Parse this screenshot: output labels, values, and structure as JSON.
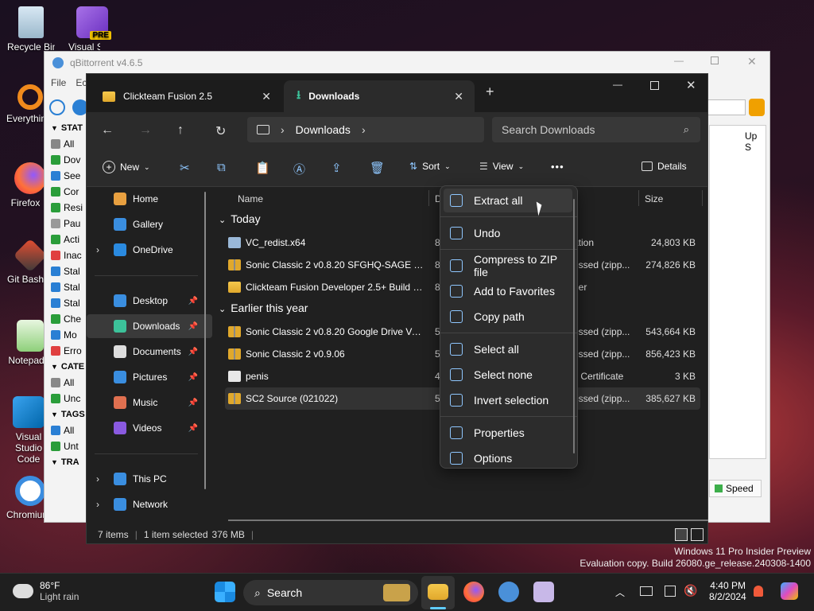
{
  "desktop": {
    "icons": [
      {
        "label": "Recycle Bin"
      },
      {
        "label": "Visual Studio"
      },
      {
        "label": "Everything"
      },
      {
        "label": "Firefox"
      },
      {
        "label": "Git Bash"
      },
      {
        "label": "Notepad"
      },
      {
        "label": "Visual Studio Code"
      },
      {
        "label": "Chromium"
      }
    ],
    "pre_badge": "PRE",
    "watermark_line1": "Windows 11 Pro Insider Preview",
    "watermark_line2": "Evaluation copy. Build 26080.ge_release.240308-1400"
  },
  "qbittorrent": {
    "title": "qBittorrent v4.6.5",
    "menu": [
      "File",
      "Ec"
    ],
    "sidebar": [
      {
        "label": "STAT",
        "header": true
      },
      {
        "label": "All"
      },
      {
        "label": "Dov"
      },
      {
        "label": "See"
      },
      {
        "label": "Cor"
      },
      {
        "label": "Resi"
      },
      {
        "label": "Pau"
      },
      {
        "label": "Acti"
      },
      {
        "label": "Inac"
      },
      {
        "label": "Stal"
      },
      {
        "label": "Stal"
      },
      {
        "label": "Stal"
      },
      {
        "label": "Che"
      },
      {
        "label": "Mo"
      },
      {
        "label": "Erro"
      },
      {
        "label": "CATE",
        "header": true
      },
      {
        "label": "All"
      },
      {
        "label": "Unc"
      },
      {
        "label": "TAGS",
        "header": true
      },
      {
        "label": "All"
      },
      {
        "label": "Unt"
      },
      {
        "label": "TRA",
        "header": true
      }
    ],
    "column_up": "Up S",
    "speed_button": "Speed"
  },
  "explorer": {
    "tabs": [
      {
        "label": "Clickteam Fusion 2.5",
        "active": false
      },
      {
        "label": "Downloads",
        "active": true
      }
    ],
    "add_tab": "+",
    "breadcrumb": "Downloads",
    "search_placeholder": "Search Downloads",
    "toolbar": {
      "new": "New",
      "sort": "Sort",
      "view": "View",
      "more": "•••",
      "details": "Details"
    },
    "nav": [
      {
        "label": "Home",
        "pinned": false
      },
      {
        "label": "Gallery",
        "pinned": false
      },
      {
        "label": "OneDrive",
        "pinned": false
      },
      {
        "label": "Desktop",
        "pinned": true
      },
      {
        "label": "Downloads",
        "pinned": true,
        "selected": true
      },
      {
        "label": "Documents",
        "pinned": true
      },
      {
        "label": "Pictures",
        "pinned": true
      },
      {
        "label": "Music",
        "pinned": true
      },
      {
        "label": "Videos",
        "pinned": true
      },
      {
        "label": "This PC",
        "pinned": false
      },
      {
        "label": "Network",
        "pinned": false
      }
    ],
    "columns": {
      "name": "Name",
      "date": "D",
      "size": "Size"
    },
    "groups": [
      {
        "label": "Today",
        "files": [
          {
            "name": "VC_redist.x64",
            "date": "8",
            "type": "ation",
            "size": "24,803 KB",
            "kind": "exe"
          },
          {
            "name": "Sonic Classic 2 v0.8.20 SFGHQ-SAGE Versi...",
            "date": "8",
            "type": "essed (zipp...",
            "size": "274,826 KB",
            "kind": "zip"
          },
          {
            "name": "Clickteam Fusion Developer 2.5+ Build R...",
            "date": "8",
            "type": "der",
            "size": "",
            "kind": "folder"
          }
        ]
      },
      {
        "label": "Earlier this year",
        "files": [
          {
            "name": "Sonic Classic 2 v0.8.20 Google Drive Versi...",
            "date": "5",
            "type": "essed (zipp...",
            "size": "543,664 KB",
            "kind": "zip"
          },
          {
            "name": "Sonic Classic 2 v0.9.06",
            "date": "5",
            "type": "essed (zipp...",
            "size": "856,423 KB",
            "kind": "zip"
          },
          {
            "name": "penis",
            "date": "4",
            "type": "y Certificate",
            "size": "3 KB",
            "kind": "cert"
          },
          {
            "name": "SC2 Source (021022)",
            "date": "5",
            "type": "essed (zipp...",
            "size": "385,627 KB",
            "kind": "zip",
            "selected": true
          }
        ]
      }
    ],
    "context_menu": [
      {
        "label": "Extract all",
        "hover": true
      },
      {
        "label": "Undo"
      },
      {
        "label": "Compress to ZIP file"
      },
      {
        "label": "Add to Favorites"
      },
      {
        "label": "Copy path"
      },
      {
        "label": "Select all"
      },
      {
        "label": "Select none"
      },
      {
        "label": "Invert selection"
      },
      {
        "label": "Properties"
      },
      {
        "label": "Options"
      }
    ],
    "status": {
      "items": "7 items",
      "selected": "1 item selected",
      "size": "376 MB"
    }
  },
  "taskbar": {
    "weather_temp": "86°F",
    "weather_desc": "Light rain",
    "search": "Search",
    "time": "4:40 PM",
    "date": "8/2/2024"
  },
  "colors": {
    "accent": "#60cdff",
    "folder": "#f0bb3c",
    "explorer_bg": "#202020"
  }
}
